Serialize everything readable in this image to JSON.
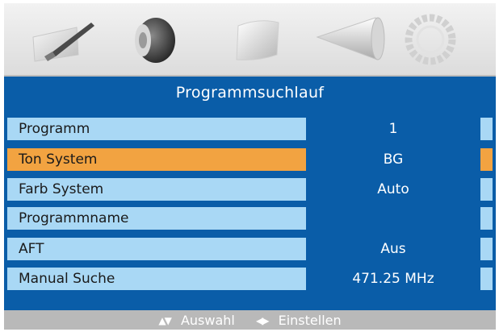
{
  "icons": [
    "picture-icon",
    "sound-icon",
    "feature-icon",
    "channel-search-icon",
    "setup-icon"
  ],
  "menu": {
    "title": "Programmsuchlauf",
    "rows": [
      {
        "label": "Programm",
        "value": "1"
      },
      {
        "label": "Ton System",
        "value": "BG"
      },
      {
        "label": "Farb System",
        "value": "Auto"
      },
      {
        "label": "Programmname",
        "value": ""
      },
      {
        "label": "AFT",
        "value": "Aus"
      },
      {
        "label": "Manual Suche",
        "value": "471.25 MHz"
      }
    ],
    "selected_index": 1
  },
  "footer": {
    "nav_label": "Auswahl",
    "adjust_label": "Einstellen"
  },
  "colors": {
    "osd_blue": "#0a5da8",
    "row_light_blue": "#a9d8f5",
    "highlight_orange": "#f2a341",
    "footer_gray": "#b9b9b9"
  }
}
